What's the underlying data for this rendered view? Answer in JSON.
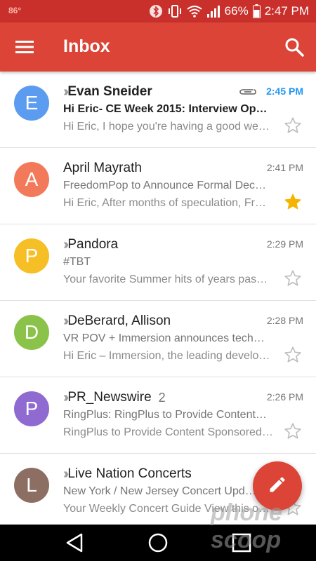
{
  "status_bar": {
    "temperature": "86°",
    "battery_percent": "66%",
    "time": "2:47 PM",
    "icons": [
      "bluetooth-icon",
      "vibrate-icon",
      "wifi-icon",
      "signal-icon",
      "battery-icon"
    ]
  },
  "app_bar": {
    "title": "Inbox",
    "menu_icon": "hamburger-menu-icon",
    "search_icon": "search-icon"
  },
  "colors": {
    "header": "#db4437",
    "status_bar": "#c9302c",
    "unread_time": "#2196f3",
    "star_filled": "#f4b400"
  },
  "emails": [
    {
      "initial": "E",
      "avatar_color": "#5c9cf0",
      "sender": "Evan Sneider",
      "count": "",
      "time": "2:45 PM",
      "subject": "Hi Eric- CE Week 2015: Interview Op…",
      "snippet": "Hi Eric, I hope you're having a good we…",
      "unread": true,
      "important": true,
      "attachment": true,
      "starred": false
    },
    {
      "initial": "A",
      "avatar_color": "#f2795a",
      "sender": "April Mayrath",
      "count": "",
      "time": "2:41 PM",
      "subject": "FreedomPop to Announce Formal Dec…",
      "snippet": "Hi Eric, After months of speculation, Fr…",
      "unread": false,
      "important": false,
      "attachment": false,
      "starred": true
    },
    {
      "initial": "P",
      "avatar_color": "#f6bf26",
      "sender": "Pandora",
      "count": "",
      "time": "2:29 PM",
      "subject": "#TBT",
      "snippet": "Your favorite Summer hits of years pas…",
      "unread": false,
      "important": true,
      "attachment": false,
      "starred": false
    },
    {
      "initial": "D",
      "avatar_color": "#8bc34a",
      "sender": "DeBerard, Allison",
      "count": "",
      "time": "2:28 PM",
      "subject": "VR POV + Immersion announces tech…",
      "snippet": "Hi Eric – Immersion, the leading develo…",
      "unread": false,
      "important": true,
      "attachment": false,
      "starred": false
    },
    {
      "initial": "P",
      "avatar_color": "#8e6ad1",
      "sender": "PR_Newswire",
      "count": "2",
      "time": "2:26 PM",
      "subject": "RingPlus: RingPlus to Provide Content…",
      "snippet": "RingPlus to Provide Content Sponsored…",
      "unread": false,
      "important": true,
      "attachment": false,
      "starred": false
    },
    {
      "initial": "L",
      "avatar_color": "#8d6e63",
      "sender": "Live Nation Concerts",
      "count": "",
      "time": "",
      "subject": "New York / New Jersey Concert Upd…",
      "snippet": "Your Weekly Concert Guide View this o…",
      "unread": false,
      "important": true,
      "attachment": false,
      "starred": false
    }
  ],
  "fab": {
    "icon": "pencil-compose-icon"
  },
  "watermark": {
    "text": "phone scoop"
  },
  "nav_bar": {
    "icons": [
      "back-icon",
      "home-icon",
      "recents-icon"
    ]
  }
}
